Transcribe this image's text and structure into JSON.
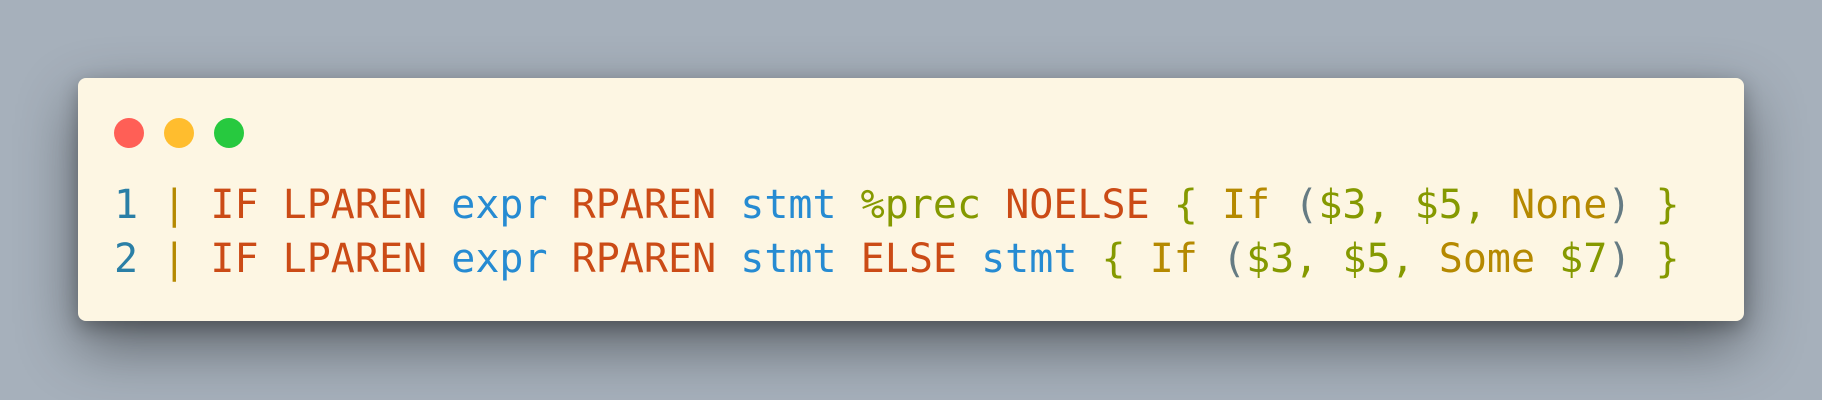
{
  "window": {
    "controls": [
      "close",
      "minimize",
      "maximize"
    ],
    "colors": {
      "background": "#fdf6e3",
      "close": "#ff5f56",
      "minimize": "#ffbd2e",
      "maximize": "#27c93f"
    }
  },
  "code": {
    "lines": [
      {
        "number": "1",
        "bar": "|",
        "t1": "IF",
        "t2": "LPAREN",
        "t3": "expr",
        "t4": "RPAREN",
        "t5": "stmt",
        "t6": "%prec",
        "t7": "NOELSE",
        "open": "{",
        "ctor": "If",
        "lp": "(",
        "a1": "$3,",
        "a2": "$5,",
        "a3": "None",
        "rp": ")",
        "close": "}"
      },
      {
        "number": "2",
        "bar": "|",
        "t1": "IF",
        "t2": "LPAREN",
        "t3": "expr",
        "t4": "RPAREN",
        "t5": "stmt",
        "t6": "ELSE",
        "t7": "stmt",
        "open": "{",
        "ctor": "If",
        "lp": "(",
        "a1": "$3,",
        "a2": "$5,",
        "a3": "Some",
        "a4": "$7",
        "rp": ")",
        "close": "}"
      }
    ]
  }
}
